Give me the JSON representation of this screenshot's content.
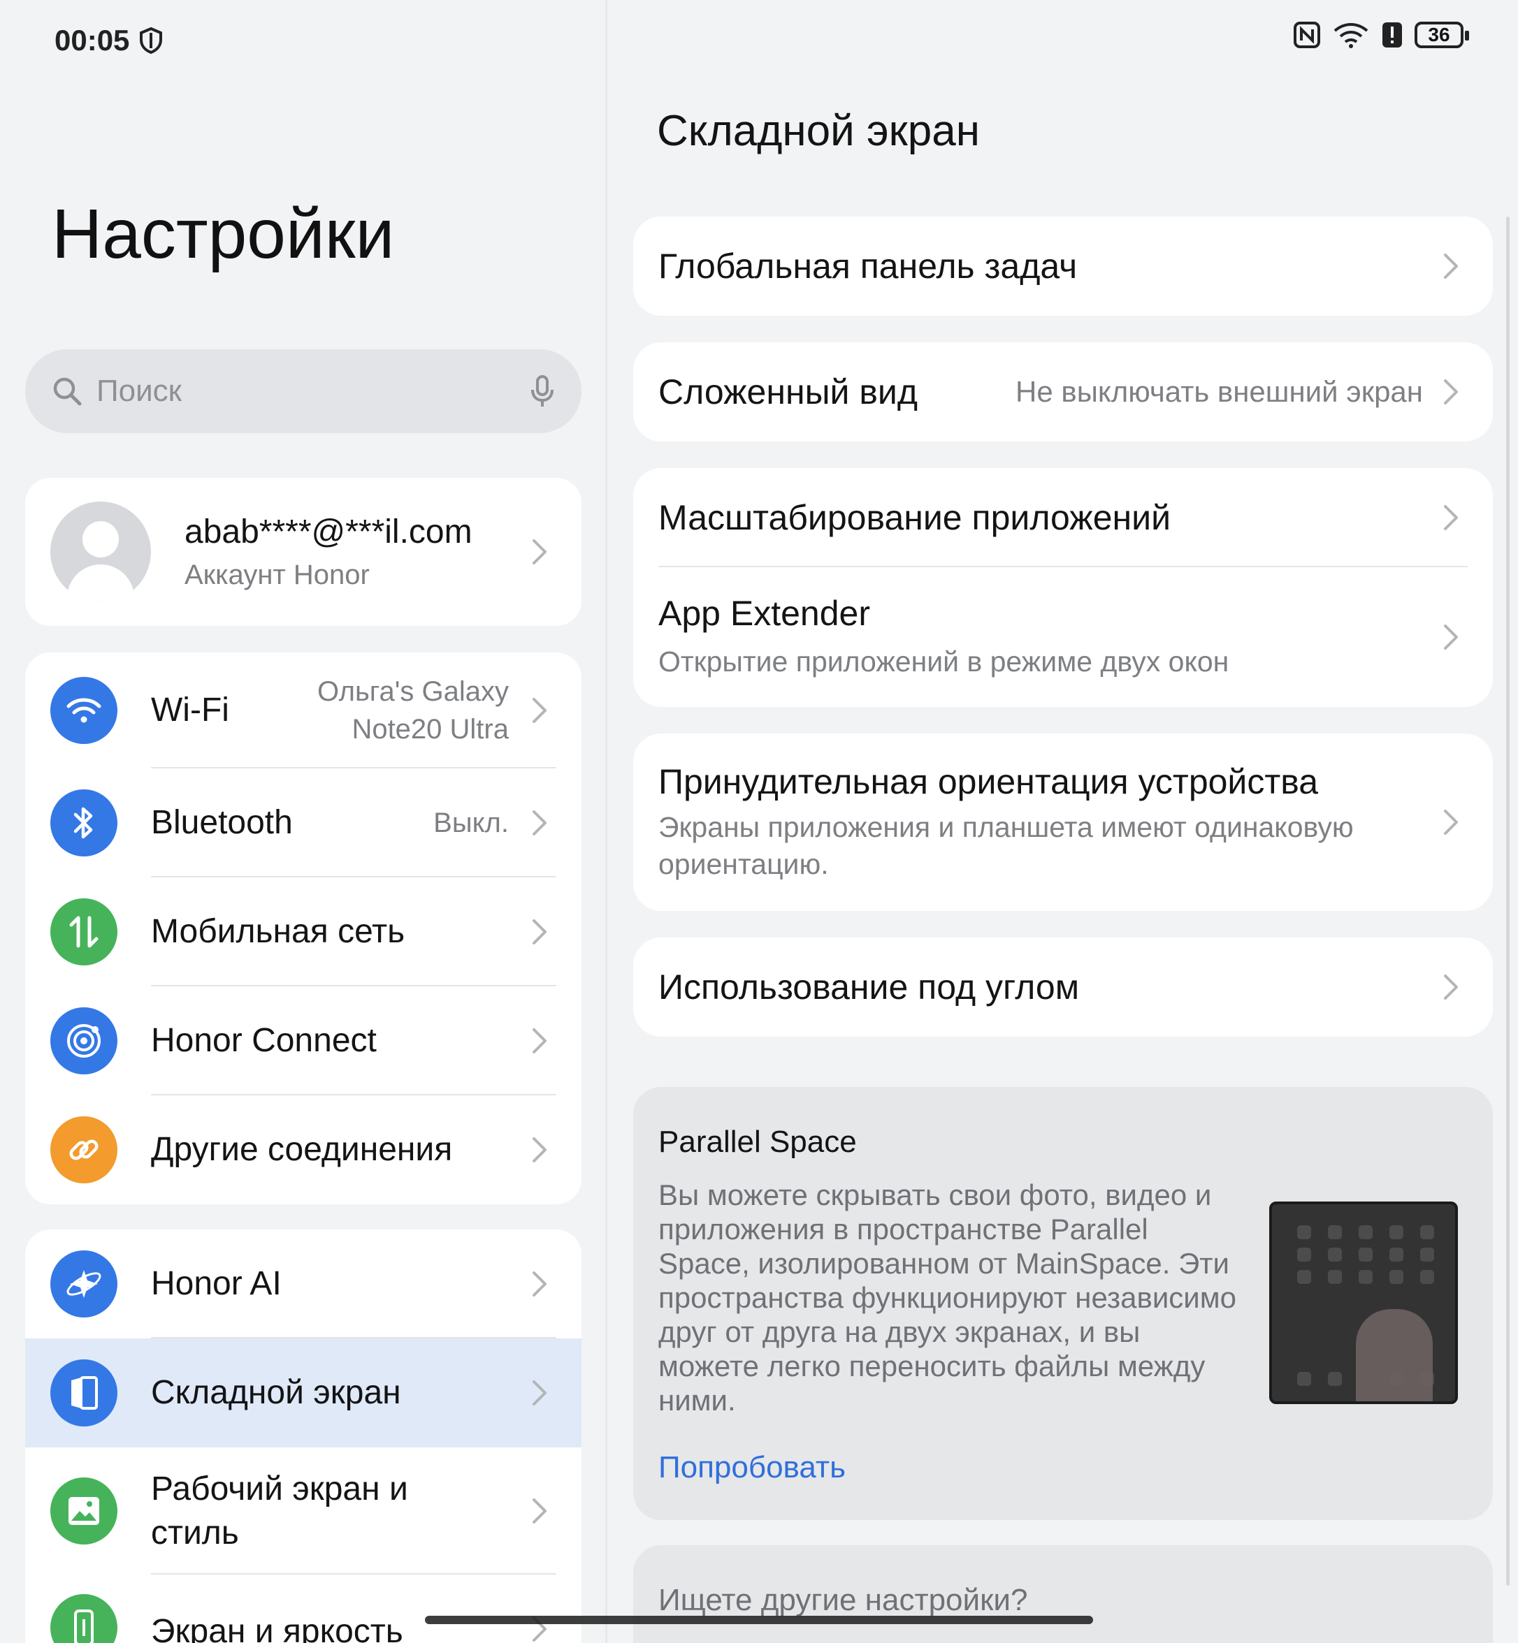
{
  "status_bar": {
    "time": "00:05",
    "battery": "36"
  },
  "left": {
    "title": "Настройки",
    "search": {
      "placeholder": "Поиск"
    },
    "account": {
      "email": "abab****@***il.com",
      "subtitle": "Аккаунт Honor"
    },
    "connections": [
      {
        "label": "Wi-Fi",
        "value": "Ольга's Galaxy\nNote20 Ultra",
        "icon": "wifi-icon",
        "color": "#3478e6"
      },
      {
        "label": "Bluetooth",
        "value": "Выкл.",
        "icon": "bluetooth-icon",
        "color": "#3478e6"
      },
      {
        "label": "Мобильная сеть",
        "value": "",
        "icon": "mobile-data-icon",
        "color": "#46b35a"
      },
      {
        "label": "Honor Connect",
        "value": "",
        "icon": "honor-connect-icon",
        "color": "#3478e6"
      },
      {
        "label": "Другие соединения",
        "value": "",
        "icon": "link-icon",
        "color": "#f39b2c"
      }
    ],
    "features": [
      {
        "label": "Honor AI",
        "icon": "honor-ai-icon",
        "color": "#3478e6"
      },
      {
        "label": "Складной экран",
        "icon": "foldable-screen-icon",
        "color": "#3478e6",
        "selected": true
      },
      {
        "label": "Рабочий экран и\nстиль",
        "icon": "wallpaper-icon",
        "color": "#46b35a"
      },
      {
        "label": "Экран и яркость",
        "icon": "display-icon",
        "color": "#46b35a"
      }
    ]
  },
  "right": {
    "title": "Складной экран",
    "rows": {
      "global_taskbar": "Глобальная панель задач",
      "folded_view": {
        "label": "Сложенный вид",
        "value": "Не выключать внешний экран"
      },
      "app_scaling": "Масштабирование приложений",
      "app_extender": {
        "label": "App Extender",
        "subtitle": "Открытие приложений в режиме двух окон"
      },
      "forced_orientation": {
        "label": "Принудительная ориентация устройства",
        "subtitle": "Экраны приложения и планшета имеют одинаковую ориентацию."
      },
      "tent_mode": "Использование под углом"
    },
    "promo": {
      "title": "Parallel Space",
      "description": "Вы можете скрывать свои фото, видео и приложения в пространстве Parallel Space, изолированном от MainSpace. Эти пространства функционируют независимо друг от друга на двух экранах, и вы можете легко переносить файлы между ними.",
      "link": "Попробовать"
    },
    "more": "Ищете другие настройки?"
  },
  "colors": {
    "accent": "#3478e6",
    "link": "#2f6fdb",
    "selected_row": "#dfe9f8"
  }
}
